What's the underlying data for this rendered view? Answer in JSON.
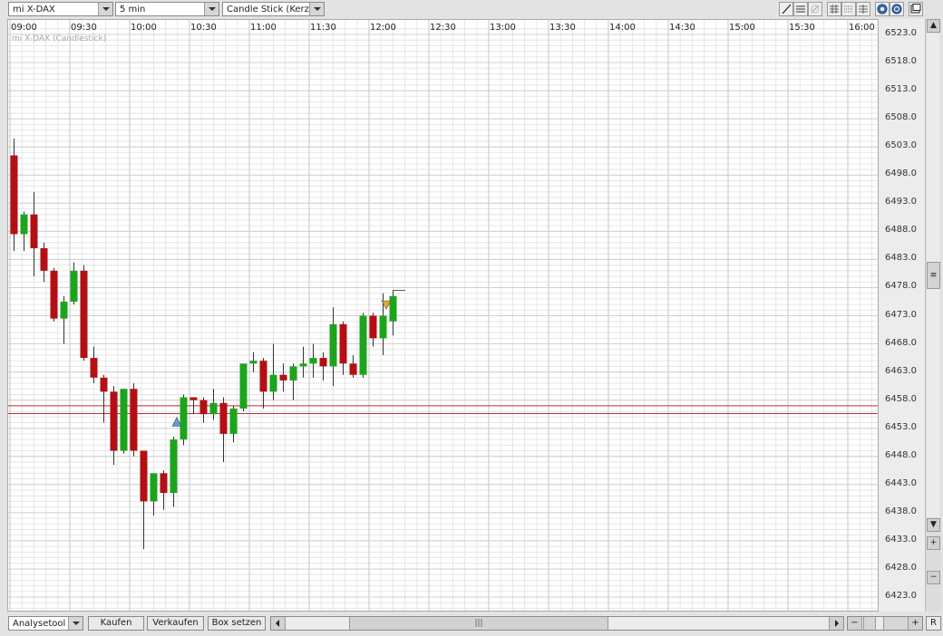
{
  "toolbar": {
    "instrument": "mi X-DAX",
    "interval": "5 min",
    "chart_type": "Candle Stick (Kerzen)",
    "tool_icons": [
      "draw-line-icon",
      "horizontal-lines-icon",
      "eraser-icon",
      "grid-icon",
      "dotted-grid-icon",
      "columns-icon",
      "zoom-in-icon",
      "zoom-out-icon",
      "maximize-icon"
    ]
  },
  "chart": {
    "title": "mi X-DAX (Candlestick)",
    "x_labels": [
      "09:00",
      "09:30",
      "10:00",
      "10:30",
      "11:00",
      "11:30",
      "12:00",
      "12:30",
      "13:00",
      "13:30",
      "14:00",
      "14:30",
      "15:00",
      "15:30",
      "16:00"
    ],
    "y_labels": [
      "6523.0",
      "6518.0",
      "6513.0",
      "6508.0",
      "6503.0",
      "6498.0",
      "6493.0",
      "6488.0",
      "6483.0",
      "6478.0",
      "6473.0",
      "6468.0",
      "6463.0",
      "6458.0",
      "6453.0",
      "6448.0",
      "6443.0",
      "6438.0",
      "6433.0",
      "6428.0",
      "6423.0"
    ],
    "colors": {
      "up": "#1ca51c",
      "down": "#b40f14",
      "grid": "#e6e6e6",
      "hline": "#c03030"
    }
  },
  "chart_data": {
    "type": "candlestick",
    "title": "mi X-DAX (Candlestick)",
    "xlabel": "",
    "ylabel": "",
    "ylim": [
      6421,
      6524
    ],
    "x_range": [
      "09:00",
      "16:10"
    ],
    "grid": true,
    "horizontal_lines": [
      6457.0,
      6455.6
    ],
    "candles": [
      {
        "t": "09:00",
        "o": 6501.5,
        "h": 6504.5,
        "l": 6484.5,
        "c": 6487.5
      },
      {
        "t": "09:05",
        "o": 6487.5,
        "h": 6491.5,
        "l": 6484.5,
        "c": 6491.0
      },
      {
        "t": "09:10",
        "o": 6491.0,
        "h": 6495.0,
        "l": 6480.0,
        "c": 6485.0
      },
      {
        "t": "09:15",
        "o": 6485.0,
        "h": 6486.0,
        "l": 6479.0,
        "c": 6481.0
      },
      {
        "t": "09:20",
        "o": 6481.0,
        "h": 6481.5,
        "l": 6472.0,
        "c": 6472.5
      },
      {
        "t": "09:25",
        "o": 6472.5,
        "h": 6476.5,
        "l": 6468.0,
        "c": 6475.5
      },
      {
        "t": "09:30",
        "o": 6475.5,
        "h": 6482.5,
        "l": 6475.0,
        "c": 6481.0
      },
      {
        "t": "09:35",
        "o": 6481.0,
        "h": 6482.0,
        "l": 6465.0,
        "c": 6465.5
      },
      {
        "t": "09:40",
        "o": 6465.5,
        "h": 6467.5,
        "l": 6461.0,
        "c": 6462.0
      },
      {
        "t": "09:45",
        "o": 6462.0,
        "h": 6462.5,
        "l": 6454.0,
        "c": 6459.5
      },
      {
        "t": "09:50",
        "o": 6459.5,
        "h": 6460.5,
        "l": 6446.5,
        "c": 6449.0
      },
      {
        "t": "09:55",
        "o": 6449.0,
        "h": 6460.0,
        "l": 6448.5,
        "c": 6460.0
      },
      {
        "t": "10:00",
        "o": 6460.0,
        "h": 6461.0,
        "l": 6448.0,
        "c": 6449.0
      },
      {
        "t": "10:05",
        "o": 6449.0,
        "h": 6449.0,
        "l": 6431.5,
        "c": 6440.0
      },
      {
        "t": "10:10",
        "o": 6440.0,
        "h": 6445.0,
        "l": 6437.5,
        "c": 6445.0
      },
      {
        "t": "10:15",
        "o": 6445.0,
        "h": 6445.5,
        "l": 6438.5,
        "c": 6441.5
      },
      {
        "t": "10:20",
        "o": 6441.5,
        "h": 6451.5,
        "l": 6439.0,
        "c": 6451.0
      },
      {
        "t": "10:25",
        "o": 6451.0,
        "h": 6459.0,
        "l": 6450.0,
        "c": 6458.5
      },
      {
        "t": "10:30",
        "o": 6458.5,
        "h": 6458.5,
        "l": 6455.5,
        "c": 6458.0
      },
      {
        "t": "10:35",
        "o": 6458.0,
        "h": 6458.5,
        "l": 6454.0,
        "c": 6455.5
      },
      {
        "t": "10:40",
        "o": 6455.5,
        "h": 6460.0,
        "l": 6454.5,
        "c": 6457.5
      },
      {
        "t": "10:45",
        "o": 6457.5,
        "h": 6458.5,
        "l": 6447.0,
        "c": 6452.0
      },
      {
        "t": "10:50",
        "o": 6452.0,
        "h": 6457.0,
        "l": 6450.5,
        "c": 6456.5
      },
      {
        "t": "10:55",
        "o": 6456.5,
        "h": 6461.0,
        "l": 6456.0,
        "c": 6464.5
      },
      {
        "t": "11:00",
        "o": 6464.5,
        "h": 6466.5,
        "l": 6463.0,
        "c": 6465.0
      },
      {
        "t": "11:05",
        "o": 6465.0,
        "h": 6465.5,
        "l": 6456.5,
        "c": 6459.5
      },
      {
        "t": "11:10",
        "o": 6459.5,
        "h": 6468.0,
        "l": 6458.0,
        "c": 6462.5
      },
      {
        "t": "11:15",
        "o": 6462.5,
        "h": 6464.5,
        "l": 6459.5,
        "c": 6461.5
      },
      {
        "t": "11:20",
        "o": 6461.5,
        "h": 6464.5,
        "l": 6458.0,
        "c": 6464.0
      },
      {
        "t": "11:25",
        "o": 6464.0,
        "h": 6467.5,
        "l": 6462.0,
        "c": 6464.5
      },
      {
        "t": "11:30",
        "o": 6464.5,
        "h": 6468.0,
        "l": 6462.0,
        "c": 6465.5
      },
      {
        "t": "11:35",
        "o": 6465.5,
        "h": 6466.5,
        "l": 6461.5,
        "c": 6464.0
      },
      {
        "t": "11:40",
        "o": 6464.0,
        "h": 6474.5,
        "l": 6460.5,
        "c": 6471.5
      },
      {
        "t": "11:45",
        "o": 6471.5,
        "h": 6472.0,
        "l": 6462.5,
        "c": 6464.5
      },
      {
        "t": "11:50",
        "o": 6464.5,
        "h": 6466.0,
        "l": 6462.0,
        "c": 6462.5
      },
      {
        "t": "11:55",
        "o": 6462.5,
        "h": 6473.5,
        "l": 6462.0,
        "c": 6473.0
      },
      {
        "t": "12:00",
        "o": 6473.0,
        "h": 6473.5,
        "l": 6467.5,
        "c": 6469.0
      },
      {
        "t": "12:05",
        "o": 6469.0,
        "h": 6477.0,
        "l": 6466.0,
        "c": 6473.0
      },
      {
        "t": "12:10",
        "o": 6472.0,
        "h": 6477.5,
        "l": 6469.5,
        "c": 6476.5
      }
    ],
    "markers": [
      {
        "t": "10:25",
        "price": 6454.0,
        "type": "buy",
        "color": "#5b9bd5"
      },
      {
        "t": "12:10",
        "price": 6475.0,
        "type": "sell",
        "color": "#f0a030"
      }
    ]
  },
  "bottom": {
    "analysis_tool": "Analysetool",
    "buy_label": "Kaufen",
    "sell_label": "Verkaufen",
    "box_label": "Box setzen",
    "zoom_minus": "−",
    "zoom_plus": "+",
    "reset_label": "R",
    "scroll_grip": "|||"
  },
  "vscroll": {
    "grip": "≡"
  }
}
